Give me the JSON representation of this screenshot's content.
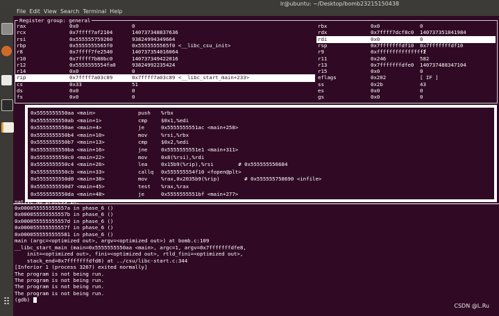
{
  "window": {
    "title": "lr@ubuntu: ~/Desktop/bomb23215150438"
  },
  "menu": [
    "File",
    "Edit",
    "View",
    "Search",
    "Terminal",
    "Help"
  ],
  "launcher_icons": [
    "files-icon",
    "firefox-icon",
    "text-editor-icon",
    "terminal-icon",
    "notes-icon",
    "app-grid-icon"
  ],
  "registers": {
    "group_label": "Register group: general",
    "rows": [
      {
        "l": [
          "rax",
          "0x0",
          "0"
        ],
        "r": [
          "rbx",
          "0x0",
          "0"
        ]
      },
      {
        "l": [
          "rcx",
          "0x7ffff7af2104",
          "140737348837636"
        ],
        "r": [
          "rdx",
          "0x7ffff7dcf8c0",
          "140737351841984"
        ]
      },
      {
        "l": [
          "rsi",
          "0x555555759260",
          "93824994349664"
        ],
        "r": [
          "rdi",
          "0x0",
          "0"
        ],
        "sel_right": true
      },
      {
        "l": [
          "rbp",
          "0x5555555565f0",
          "0x5555555565f0 <__libc_csu_init>"
        ],
        "r": [
          "rsp",
          "0x7fffffffdf10",
          "0x7fffffffdf10"
        ]
      },
      {
        "l": [
          "r8",
          "0x7ffff7fe2540",
          "140737354016064"
        ],
        "r": [
          "r9",
          "0xffffffffffffffff",
          "-2"
        ]
      },
      {
        "l": [
          "r10",
          "0x7ffff7b80bc0",
          "140737349422016"
        ],
        "r": [
          "r11",
          "0x246",
          "582"
        ]
      },
      {
        "l": [
          "r12",
          "0x5555555554fa0",
          "93824992235424"
        ],
        "r": [
          "r13",
          "0x7fffffffdfe0",
          "140737488347104"
        ]
      },
      {
        "l": [
          "r14",
          "0x0",
          "0"
        ],
        "r": [
          "r15",
          "0x0",
          "0"
        ]
      },
      {
        "l": [
          "rip",
          "0x7ffff7a03c89",
          "0x7ffff7a03c89 <__libc_start_main+233>"
        ],
        "r": [
          "eflags",
          "0x202",
          "[ IF ]"
        ],
        "sel_left": true
      },
      {
        "l": [
          "cs",
          "0x33",
          "51"
        ],
        "r": [
          "ss",
          "0x2b",
          "43"
        ]
      },
      {
        "l": [
          "ds",
          "0x0",
          "0"
        ],
        "r": [
          "es",
          "0x0",
          "0"
        ]
      },
      {
        "l": [
          "fs",
          "0x0",
          "0"
        ],
        "r": [
          "gs",
          "0x0",
          "0"
        ]
      }
    ]
  },
  "assembly": [
    {
      "addr": "0x5555555550aa <main>",
      "op": "push",
      "args": "%rbx"
    },
    {
      "addr": "0x5555555550ab <main+1>",
      "op": "cmp",
      "args": "$0x1,%edi"
    },
    {
      "addr": "0x5555555550ae <main+4>",
      "op": "je",
      "args": "0x5555555551ac <main+258>"
    },
    {
      "addr": "0x5555555550b4 <main+10>",
      "op": "mov",
      "args": "%rsi,%rbx"
    },
    {
      "addr": "0x5555555550b7 <main+13>",
      "op": "cmp",
      "args": "$0x2,%edi"
    },
    {
      "addr": "0x5555555550ba <main+16>",
      "op": "jne",
      "args": "0x5555555551e1 <main+311>"
    },
    {
      "addr": "0x5555555550c0 <main+22>",
      "op": "mov",
      "args": "0x8(%rsi),%rdi"
    },
    {
      "addr": "0x5555555550c4 <main+26>",
      "op": "lea",
      "args": "0x15b9(%rip),%rsi        # 0x555555556684"
    },
    {
      "addr": "0x5555555550cb <main+33>",
      "op": "callq",
      "args": "0x555555554f10 <fopen@plt>"
    },
    {
      "addr": "0x5555555550d0 <main+38>",
      "op": "mov",
      "args": "%rax,0x2035b9(%rip)        # 0x555555758690 <infile>"
    },
    {
      "addr": "0x5555555550d7 <main+45>",
      "op": "test",
      "args": "%rax,%rax"
    },
    {
      "addr": "0x5555555550da <main+48>",
      "op": "je",
      "args": "0x5555555551bf <main+277>"
    }
  ],
  "status_line": "native No process In:",
  "output": [
    "0x000055555555557a in phase_6 ()",
    "0x000055555555557b in phase_6 ()",
    "0x000055555555557d in phase_6 ()",
    "0x000055555555557f in phase_6 ()",
    "0x0000555555555581 in phase_6 ()",
    "main (argc=<optimized out>, argv=<optimized out>) at bomb.c:109",
    "__libc_start_main (main=0x5555555550aa <main>, argc=1, argv=0x7fffffffdfe8,",
    "    init=<optimized out>, fini=<optimized out>, rtld_fini=<optimized out>,",
    "    stack_end=0x7fffffffdfd8) at ../csu/libc-start.c:344",
    "[Inferior 1 (process 3267) exited normally]",
    "The program is not being run.",
    "The program is not being run.",
    "The program is not being run.",
    "The program is not being run."
  ],
  "prompt": "(gdb) ",
  "watermark": "CSDN @L.Ru"
}
